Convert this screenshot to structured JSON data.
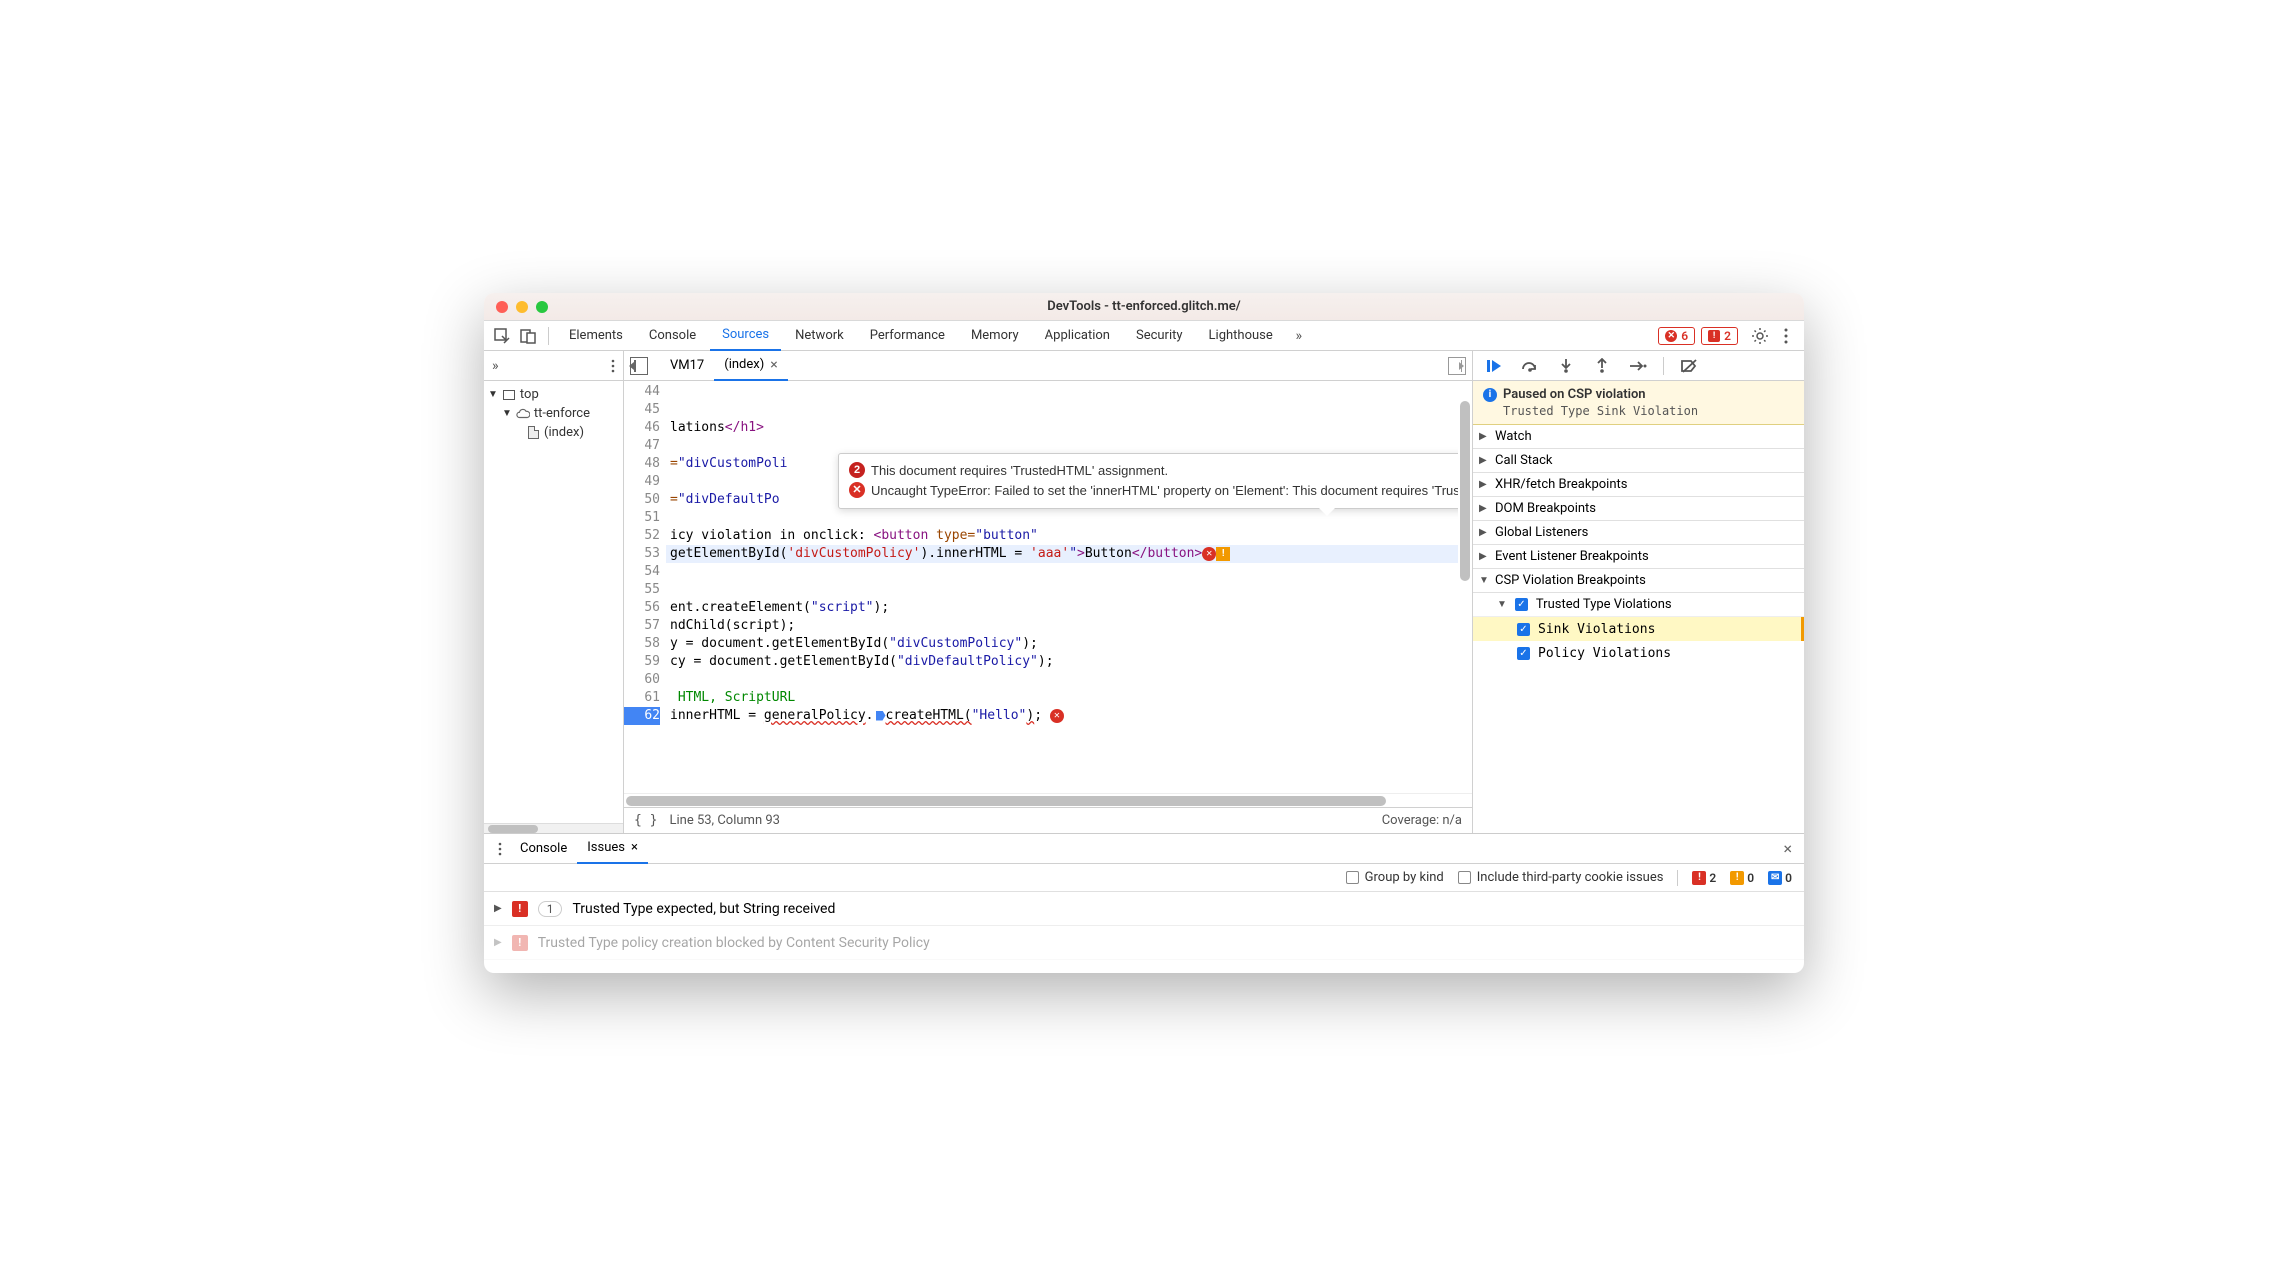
{
  "window": {
    "title": "DevTools - tt-enforced.glitch.me/"
  },
  "tabs": {
    "items": [
      "Elements",
      "Console",
      "Sources",
      "Network",
      "Performance",
      "Memory",
      "Application",
      "Security",
      "Lighthouse"
    ],
    "active": "Sources",
    "more_glyph": "»",
    "error_count": "6",
    "issue_count": "2"
  },
  "left": {
    "more_glyph": "»",
    "tree": {
      "top": "top",
      "domain": "tt-enforce",
      "file": "(index)"
    }
  },
  "source_tabs": {
    "vm_tab": "VM17",
    "active_tab": "(index)"
  },
  "code": {
    "first_line": 44,
    "lines": {
      "l44": "",
      "l45": "",
      "l46": "lations</h1>",
      "l47": "",
      "l48": "=\"divCustomPoli",
      "l49": "",
      "l50": "=\"divDefaultPo",
      "l51": "",
      "l52": "icy violation in onclick: <button type=\"button\"",
      "l53": "getElementById('divCustomPolicy').innerHTML = 'aaa'\">Button</button>",
      "l54": "",
      "l55": "",
      "l56": "ent.createElement(\"script\");",
      "l57": "ndChild(script);",
      "l58": "y = document.getElementById(\"divCustomPolicy\");",
      "l59": "cy = document.getElementById(\"divDefaultPolicy\");",
      "l60": "",
      "l61": " HTML, ScriptURL",
      "l62": "innerHTML = generalPolicy.createHTML(\"Hello\");"
    }
  },
  "tooltip": {
    "count": "2",
    "msg1": "This document requires 'TrustedHTML' assignment.",
    "msg2": "Uncaught TypeError: Failed to set the 'innerHTML' property on 'Element': This document requires 'TrustedHTML' assignment."
  },
  "status": {
    "pretty": "{ }",
    "pos": "Line 53, Column 93",
    "coverage": "Coverage: n/a"
  },
  "debugger": {
    "pause_title": "Paused on CSP violation",
    "pause_detail": "Trusted Type Sink Violation",
    "panels": {
      "watch": "Watch",
      "callstack": "Call Stack",
      "xhr": "XHR/fetch Breakpoints",
      "dom": "DOM Breakpoints",
      "global": "Global Listeners",
      "event": "Event Listener Breakpoints",
      "csp": "CSP Violation Breakpoints",
      "tt": "Trusted Type Violations",
      "sink": "Sink Violations",
      "policy": "Policy Violations"
    }
  },
  "drawer": {
    "console_tab": "Console",
    "issues_tab": "Issues",
    "group_by_kind": "Group by kind",
    "include_cookie": "Include third-party cookie issues",
    "counts": {
      "red": "2",
      "yel": "0",
      "blu": "0"
    },
    "issue1": {
      "count": "1",
      "text": "Trusted Type expected, but String received"
    },
    "issue2": {
      "text": "Trusted Type policy creation blocked by Content Security Policy"
    }
  }
}
